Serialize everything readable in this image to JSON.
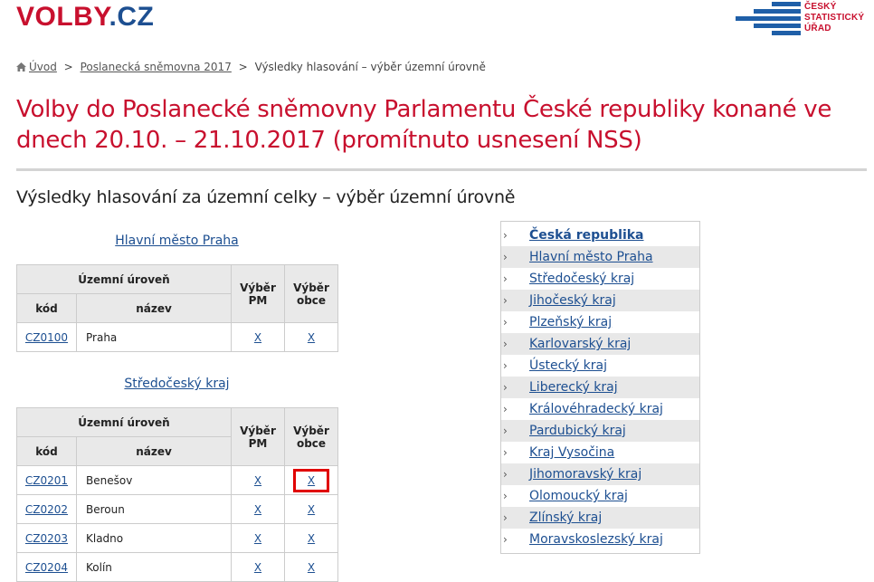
{
  "header": {
    "logo_part1": "VOLBY",
    "logo_part2": ".CZ",
    "csu_line1": "ČESKÝ",
    "csu_line2": "STATISTICKÝ",
    "csu_line3": "ÚŘAD"
  },
  "breadcrumb": {
    "home": "Úvod",
    "level1": "Poslanecká sněmovna 2017",
    "current": "Výsledky hlasování – výběr územní úrovně",
    "separator": ">"
  },
  "page": {
    "title": "Volby do Poslanecké sněmovny Parlamentu České republiky konané ve dnech 20.10. – 21.10.2017 (promítnuto usnesení NSS)",
    "subtitle": "Výsledky hlasování za územní celky – výběr územní úrovně"
  },
  "table_headers": {
    "territorial_level": "Územní úroveň",
    "select_pm_line1": "Výběr",
    "select_pm_line2": "PM",
    "select_municipality_line1": "Výběr",
    "select_municipality_line2": "obce",
    "code": "kód",
    "name": "název"
  },
  "regions": [
    {
      "title": "Hlavní město Praha",
      "rows": [
        {
          "code": "CZ0100",
          "name": "Praha",
          "pm": "X",
          "obce": "X"
        }
      ]
    },
    {
      "title": "Středočeský kraj",
      "rows": [
        {
          "code": "CZ0201",
          "name": "Benešov",
          "pm": "X",
          "obce": "X"
        },
        {
          "code": "CZ0202",
          "name": "Beroun",
          "pm": "X",
          "obce": "X"
        },
        {
          "code": "CZ0203",
          "name": "Kladno",
          "pm": "X",
          "obce": "X"
        },
        {
          "code": "CZ0204",
          "name": "Kolín",
          "pm": "X",
          "obce": "X"
        }
      ]
    }
  ],
  "side_nav": {
    "items": [
      "Česká republika",
      "Hlavní město Praha",
      "Středočeský kraj",
      "Jihočeský kraj",
      "Plzeňský kraj",
      "Karlovarský kraj",
      "Ústecký kraj",
      "Liberecký kraj",
      "Královéhradecký kraj",
      "Pardubický kraj",
      "Kraj Vysočina",
      "Jihomoravský kraj",
      "Olomoucký kraj",
      "Zlínský kraj",
      "Moravskoslezský kraj"
    ],
    "chevron": "›"
  },
  "colors": {
    "brand_red": "#c8102e",
    "link_blue": "#1d4f91",
    "highlight": "#e00000"
  }
}
